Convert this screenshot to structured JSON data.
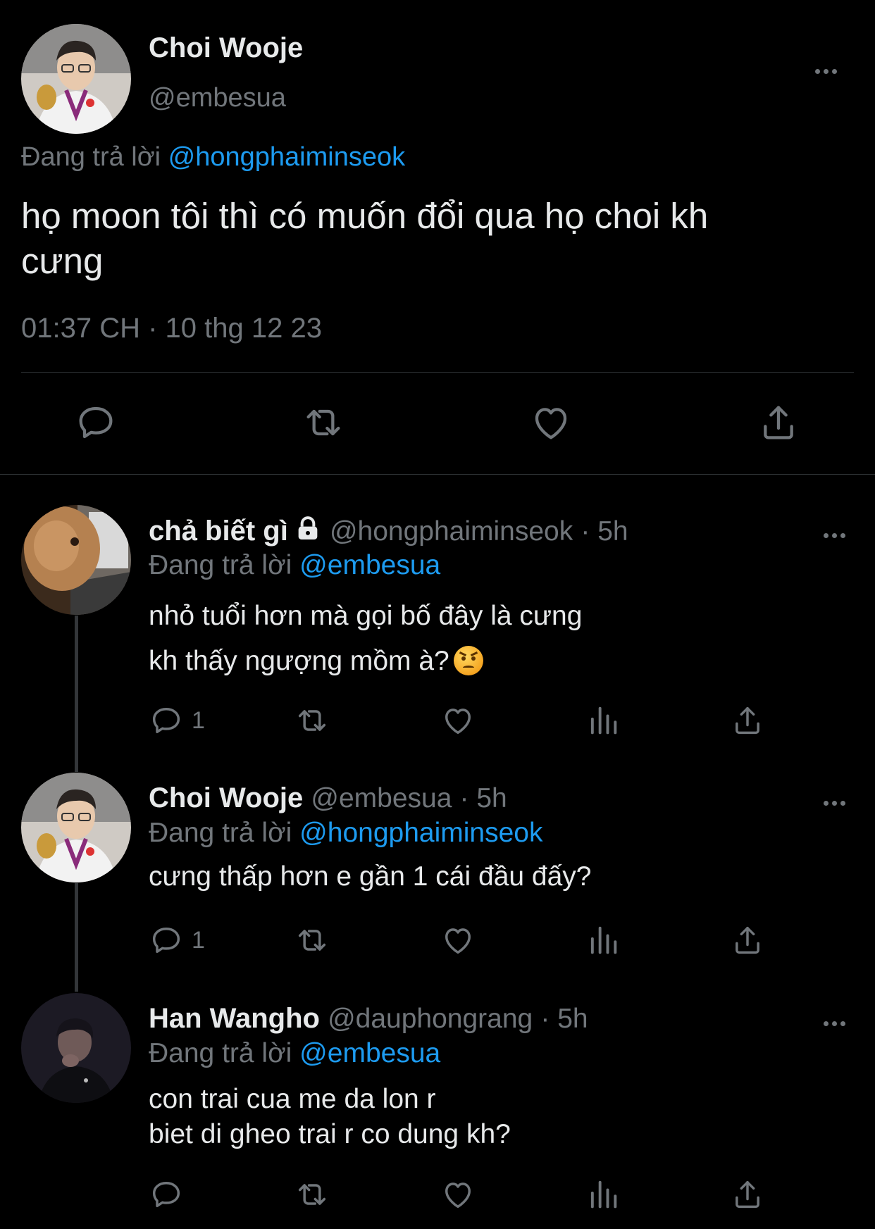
{
  "main_tweet": {
    "name": "Choi Wooje",
    "handle": "@embesua",
    "replying_prefix": "Đang trả lời",
    "replying_to": "@hongphaiminseok",
    "text": "họ moon tôi thì có muốn đổi qua họ choi kh\ncưng",
    "timestamp": "01:37 CH · 10 thg 12 23",
    "avatar": "avatar-photo"
  },
  "replies": [
    {
      "name": "chả biết gì",
      "locked": true,
      "handle": "@hongphaiminseok",
      "time": "5h",
      "replying_prefix": "Đang trả lời",
      "replying_to": "@embesua",
      "text": "nhỏ tuổi hơn mà gọi bố đây là cưng\nkh thấy ngượng mồm à?",
      "emoji": "angry-face",
      "reply_count": "1"
    },
    {
      "name": "Choi Wooje",
      "handle": "@embesua",
      "time": "5h",
      "replying_prefix": "Đang trả lời",
      "replying_to": "@hongphaiminseok",
      "text": "cưng thấp hơn e gần 1 cái đầu đấy?",
      "reply_count": "1"
    },
    {
      "name": "Han Wangho",
      "handle": "@dauphongrang",
      "time": "5h",
      "replying_prefix": "Đang trả lời",
      "replying_to": "@embesua",
      "text": "con trai cua me da lon r\nbiet di gheo trai r co dung kh?"
    }
  ],
  "icons": [
    "reply-icon",
    "retweet-icon",
    "like-icon",
    "views-icon",
    "share-icon",
    "more-icon",
    "lock-icon"
  ],
  "colors": {
    "background": "#000000",
    "text": "#e7e9ea",
    "muted": "#71767b",
    "link": "#1d9bf0",
    "divider": "#2f3336"
  }
}
